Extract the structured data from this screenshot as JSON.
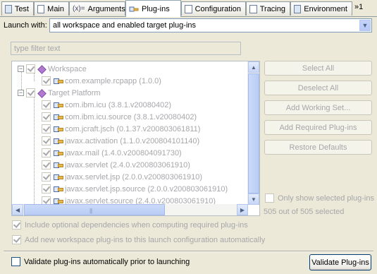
{
  "tabs": [
    {
      "label": "Test",
      "icon": "test-tab-icon"
    },
    {
      "label": "Main",
      "icon": "main-tab-icon"
    },
    {
      "label": "Arguments",
      "icon": "arguments-tab-icon"
    },
    {
      "label": "Plug-ins",
      "icon": "plugins-tab-icon",
      "active": true
    },
    {
      "label": "Configuration",
      "icon": "configuration-tab-icon"
    },
    {
      "label": "Tracing",
      "icon": "tracing-tab-icon"
    },
    {
      "label": "Environment",
      "icon": "environment-tab-icon"
    }
  ],
  "tab_overflow": "»1",
  "args_glyph": "(x)=",
  "launch": {
    "label": "Launch with:",
    "value": "all workspace and enabled target plug-ins",
    "dropdown_glyph": "▼"
  },
  "filter": {
    "placeholder": "type filter text"
  },
  "tree": {
    "items": [
      {
        "label": "Workspace",
        "type": "group",
        "expanded": true,
        "checked": true
      },
      {
        "label": "com.example.rcpapp (1.0.0)",
        "type": "plugin",
        "checked": true
      },
      {
        "label": "Target Platform",
        "type": "group",
        "expanded": true,
        "checked": true
      },
      {
        "label": "com.ibm.icu (3.8.1.v20080402)",
        "type": "plugin",
        "checked": true
      },
      {
        "label": "com.ibm.icu.source (3.8.1.v20080402)",
        "type": "plugin",
        "checked": true
      },
      {
        "label": "com.jcraft.jsch (0.1.37.v200803061811)",
        "type": "plugin",
        "checked": true
      },
      {
        "label": "javax.activation (1.1.0.v200804101140)",
        "type": "plugin",
        "checked": true
      },
      {
        "label": "javax.mail (1.4.0.v200804091730)",
        "type": "plugin",
        "checked": true
      },
      {
        "label": "javax.servlet (2.4.0.v200803061910)",
        "type": "plugin",
        "checked": true
      },
      {
        "label": "javax.servlet.jsp (2.0.0.v200803061910)",
        "type": "plugin",
        "checked": true
      },
      {
        "label": "javax.servlet.jsp.source (2.0.0.v200803061910)",
        "type": "plugin",
        "checked": true
      },
      {
        "label": "javax.servlet.source (2.4.0.v200803061910)",
        "type": "plugin",
        "checked": true
      }
    ],
    "expander_glyph": "−",
    "arrow_up": "▲",
    "arrow_down": "▼",
    "arrow_left": "◀",
    "arrow_right": "▶",
    "grip": "|||"
  },
  "buttons": {
    "select_all": "Select All",
    "deselect_all": "Deselect All",
    "add_working_set": "Add Working Set...",
    "add_required": "Add Required Plug-ins",
    "restore_defaults": "Restore Defaults",
    "validate": "Validate Plug-ins"
  },
  "only_selected": {
    "label": "Only show selected plug-ins",
    "checked": false
  },
  "count": "505 out of 505 selected",
  "options": {
    "include_optional": {
      "label": "Include optional dependencies when computing required plug-ins",
      "checked": true
    },
    "add_new_workspace": {
      "label": "Add new workspace plug-ins to this launch configuration automatically",
      "checked": true
    },
    "validate_auto": {
      "label": "Validate plug-ins automatically prior to launching",
      "checked": false
    }
  }
}
